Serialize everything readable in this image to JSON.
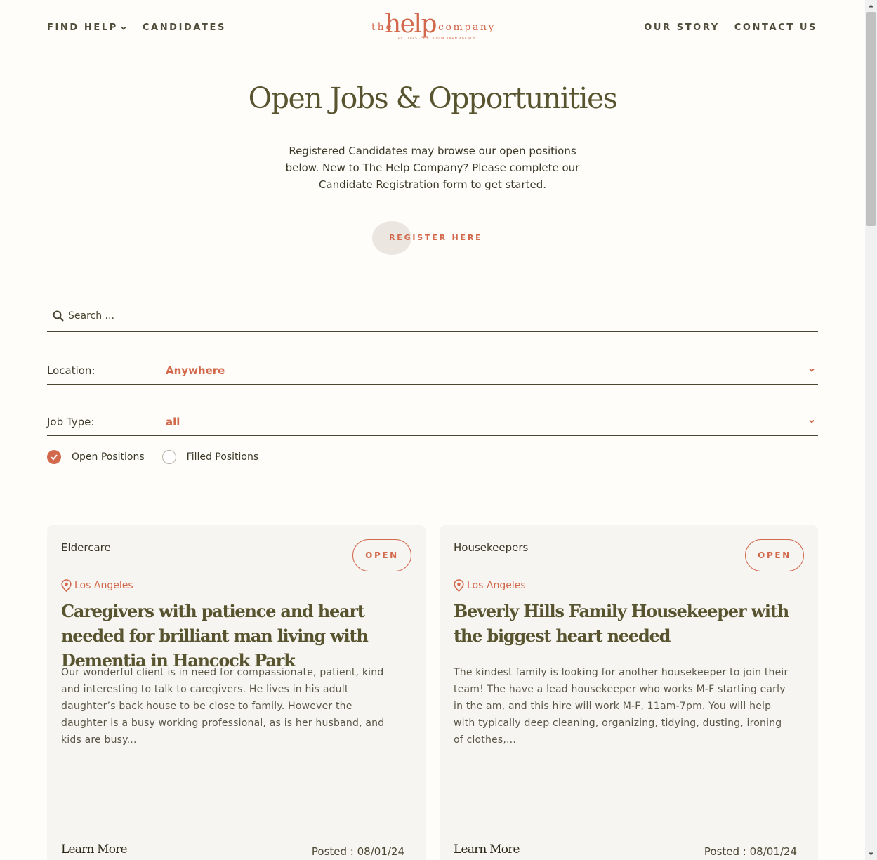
{
  "nav": {
    "find_help": "FIND HELP",
    "candidates": "CANDIDATES",
    "our_story": "OUR STORY",
    "contact_us": "CONTACT US"
  },
  "logo": {
    "the": "the",
    "help": "help",
    "company": "company",
    "tagline": "EST 1985 · A CLAUDIA KAHN AGENCY"
  },
  "hero": {
    "title": "Open Jobs & Opportunities",
    "intro": "Registered Candidates may browse our open positions below. New to The Help Company? Please complete our Candidate Registration form to get started.",
    "register_label": "REGISTER HERE"
  },
  "filters": {
    "search_placeholder": "Search ...",
    "location_label": "Location:",
    "location_value": "Anywhere",
    "jobtype_label": "Job Type:",
    "jobtype_value": "all",
    "open_label": "Open Positions",
    "filled_label": "Filled Positions",
    "open_checked": true,
    "filled_checked": false
  },
  "jobs": [
    {
      "category": "Eldercare",
      "status": "OPEN",
      "location": "Los Angeles",
      "title": "Caregivers with patience and heart needed for brilliant man living with Dementia in Hancock Park",
      "description": "Our wonderful client is in need for compassionate, patient, kind and interesting to talk to caregivers. He lives in his adult daughter’s back house to be close to family. However the daughter is a busy working professional, as is her husband, and kids are busy...",
      "learn_more": "Learn More",
      "posted": "Posted : 08/01/24"
    },
    {
      "category": "Housekeepers",
      "status": "OPEN",
      "location": "Los Angeles",
      "title": "Beverly Hills Family Housekeeper with the biggest heart needed",
      "description": "The kindest family is looking for another housekeeper to join their team! The have a lead housekeeper who works M-F starting early in the am, and this hire will work M-F, 11am-7pm. You will help with typically deep cleaning, organizing, tidying, dusting, ironing of clothes,...",
      "learn_more": "Learn More",
      "posted": "Posted : 08/01/24"
    }
  ],
  "colors": {
    "accent": "#d2684c",
    "heading": "#58542f",
    "background": "#fefdf9",
    "card": "#f7f5f1"
  },
  "icons": {
    "search": "search-icon",
    "chevron": "chevron-down-icon",
    "pin": "map-pin-icon",
    "check": "check-icon"
  }
}
